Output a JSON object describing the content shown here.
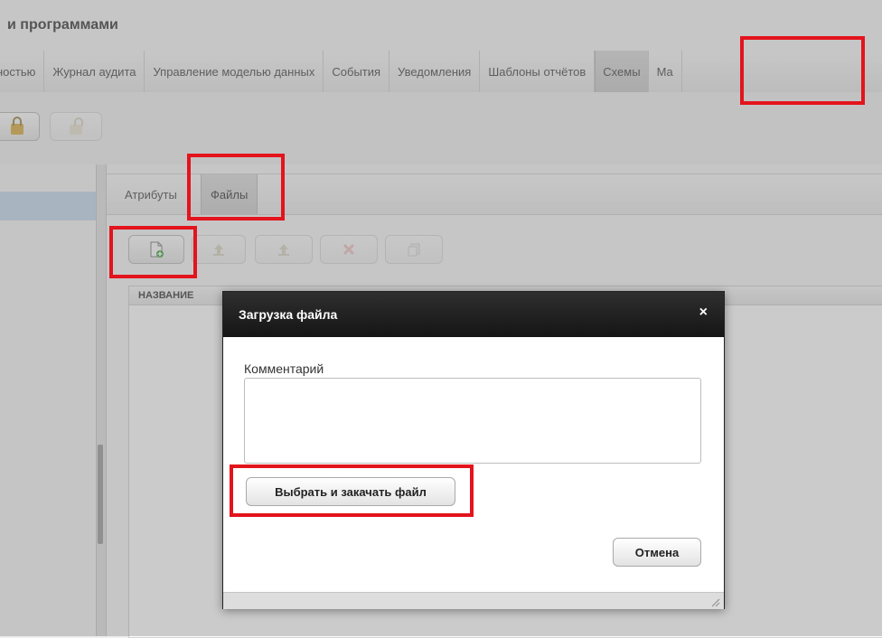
{
  "app": {
    "title": "и программами"
  },
  "main_nav": [
    {
      "label": "ностью"
    },
    {
      "label": "Журнал аудита"
    },
    {
      "label": "Управление моделью данных"
    },
    {
      "label": "События"
    },
    {
      "label": "Уведомления"
    },
    {
      "label": "Шаблоны отчётов"
    },
    {
      "label": "Схемы",
      "active": true
    },
    {
      "label": "Ма"
    }
  ],
  "toolbar": {
    "icons": [
      "lock-icon",
      "unlock-icon"
    ]
  },
  "subtabs": [
    {
      "label": "Атрибуты"
    },
    {
      "label": "Файлы",
      "active": true
    }
  ],
  "file_toolbar": {
    "icons": [
      "add-file-icon",
      "upload-icon",
      "upload-new-version-icon",
      "delete-icon",
      "copy-icon"
    ]
  },
  "grid": {
    "columns": [
      "НАЗВАНИЕ"
    ]
  },
  "dialog": {
    "title": "Загрузка файла",
    "close_symbol": "×",
    "comment_label": "Комментарий",
    "comment_value": "",
    "upload_button": "Выбрать и закачать файл",
    "cancel_button": "Отмена"
  },
  "highlight_color": "#e3141c"
}
